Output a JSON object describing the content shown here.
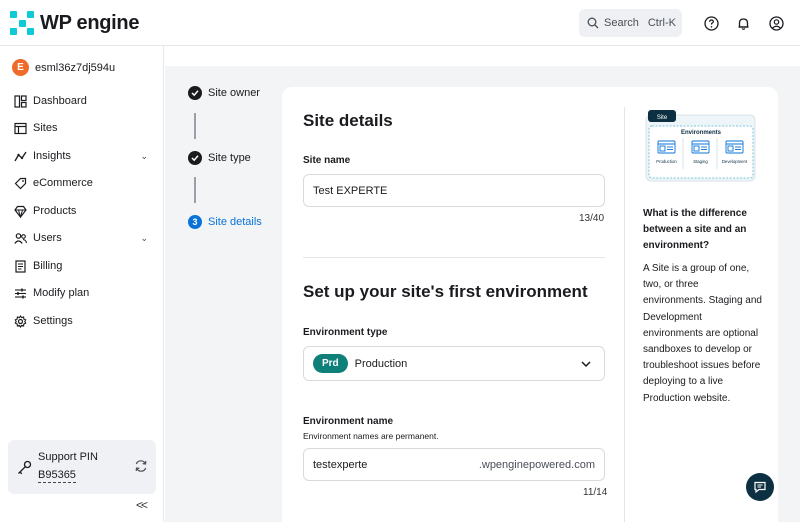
{
  "brand": {
    "logo_text": "WP engine"
  },
  "header": {
    "search_label": "Search",
    "search_shortcut": "Ctrl-K",
    "icons": [
      "help-icon",
      "bell-icon",
      "account-icon"
    ]
  },
  "sidebar": {
    "account": {
      "initial": "E",
      "name": "esml36z7dj594u"
    },
    "items": [
      {
        "label": "Dashboard",
        "icon": "dashboard-icon"
      },
      {
        "label": "Sites",
        "icon": "sites-icon"
      },
      {
        "label": "Insights",
        "icon": "insights-icon",
        "expandable": true
      },
      {
        "label": "eCommerce",
        "icon": "tag-icon"
      },
      {
        "label": "Products",
        "icon": "diamond-icon"
      },
      {
        "label": "Users",
        "icon": "users-icon",
        "expandable": true
      },
      {
        "label": "Billing",
        "icon": "billing-icon"
      },
      {
        "label": "Modify plan",
        "icon": "sliders-icon"
      },
      {
        "label": "Settings",
        "icon": "gear-icon"
      }
    ],
    "support": {
      "title": "Support PIN",
      "pin": "B95365"
    },
    "collapse_glyph": "<<"
  },
  "steps": [
    {
      "label": "Site owner",
      "state": "done"
    },
    {
      "label": "Site type",
      "state": "done"
    },
    {
      "label": "Site details",
      "state": "active",
      "number": "3"
    }
  ],
  "form": {
    "site_details_heading": "Site details",
    "site_name_label": "Site name",
    "site_name_value": "Test EXPERTE",
    "site_name_counter": "13/40",
    "env_heading": "Set up your site's first environment",
    "env_type_label": "Environment type",
    "env_type_badge": "Prd",
    "env_type_value": "Production",
    "env_name_label": "Environment name",
    "env_name_hint": "Environment names are permanent.",
    "env_name_value": "testexperte",
    "env_name_suffix": ".wpenginepowered.com",
    "env_name_counter": "11/14"
  },
  "help": {
    "illustration": {
      "tag": "Site",
      "title": "Environments",
      "envs": [
        "Production",
        "Staging",
        "Development"
      ]
    },
    "title": "What is the difference between a site and an environment?",
    "body": "A Site is a group of one, two, or three environments. Staging and Development environments are optional sandboxes to develop or troubleshoot issues before deploying to a live Production website."
  },
  "colors": {
    "accent": "#0a73d9",
    "brand": "#0ecad4",
    "badge": "#0f7f7a",
    "chat": "#0c2f42"
  }
}
